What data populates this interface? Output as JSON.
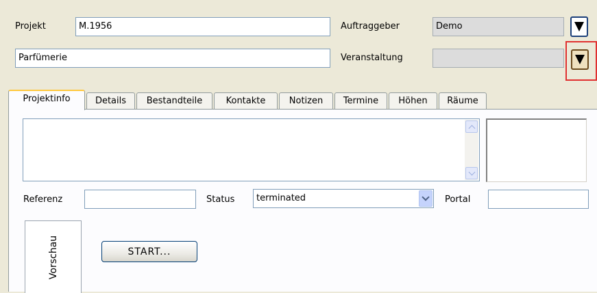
{
  "header": {
    "projekt_label": "Projekt",
    "projekt_value": "M.1956",
    "name_value": "Parfümerie",
    "auftraggeber_label": "Auftraggeber",
    "auftraggeber_value": "Demo",
    "veranstaltung_label": "Veranstaltung",
    "veranstaltung_value": ""
  },
  "tabs": [
    {
      "label": "Projektinfo",
      "active": true
    },
    {
      "label": "Details"
    },
    {
      "label": "Bestandteile"
    },
    {
      "label": "Kontakte"
    },
    {
      "label": "Notizen"
    },
    {
      "label": "Termine"
    },
    {
      "label": "Höhen"
    },
    {
      "label": "Räume"
    }
  ],
  "form": {
    "referenz_label": "Referenz",
    "referenz_value": "",
    "status_label": "Status",
    "status_value": "terminated",
    "portal_label": "Portal",
    "portal_value": ""
  },
  "preview": {
    "vorschau_label": "Vorschau",
    "start_button": "START..."
  },
  "icons": {
    "dropdown": "down-triangle-icon",
    "scroll_up": "chevron-up-icon",
    "scroll_down": "chevron-down-icon",
    "select": "chevron-down-icon"
  },
  "colors": {
    "background": "#ece9d8",
    "active_tab_accent": "#ffc83c",
    "highlight": "#e03030"
  }
}
